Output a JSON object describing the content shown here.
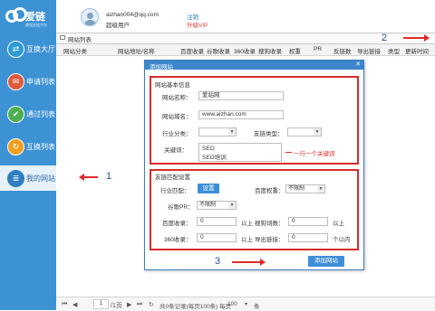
{
  "app": {
    "name": "爱链",
    "subtitle": "最强友链平台"
  },
  "sidebar": {
    "items": [
      {
        "label": "互换大厅",
        "icon": "exchange-hall-icon",
        "color": "#2f9bd6"
      },
      {
        "label": "申请列表",
        "icon": "apply-list-icon",
        "color": "#e05a3a"
      },
      {
        "label": "通过列表",
        "icon": "approved-list-icon",
        "color": "#4caf50"
      },
      {
        "label": "互换列表",
        "icon": "swap-list-icon",
        "color": "#f0a020"
      },
      {
        "label": "我的网站",
        "icon": "my-sites-icon",
        "color": "#2f7fc1"
      }
    ]
  },
  "user": {
    "email": "aizhan004@qq.com",
    "role": "超级用户",
    "logout": "注销",
    "upgrade": "升级VIP"
  },
  "tab": {
    "label": "网站列表"
  },
  "table": {
    "headers": [
      "网站分类",
      "网站地址/名称",
      "百度收录",
      "谷歌收录",
      "360收录",
      "搜狗收录",
      "权重",
      "PR",
      "反链数",
      "导出链接",
      "类型",
      "更新时间"
    ]
  },
  "pager": {
    "first": "⏮",
    "prev": "◀",
    "page": "1",
    "of": "/1页",
    "next": "▶",
    "last": "⏭",
    "refresh": "↻",
    "summary": "共0条记录(每页100条) 每页",
    "per_page": "100",
    "unit": "条"
  },
  "dialog": {
    "title": "添加网站",
    "close": "✕",
    "basic": {
      "title": "网站基本信息",
      "name_label": "网站名称：",
      "name_value": "爱站网",
      "domain_label": "网站域名：",
      "domain_value": "www.aizhan.com",
      "category_label": "行业分类：",
      "category_value": "",
      "linktype_label": "友链类型：",
      "linktype_value": "",
      "keywords_label": "关键词：",
      "keywords": [
        "SEO",
        "SEO培训"
      ],
      "keywords_note": "一行一个关键词"
    },
    "match": {
      "title": "友链匹配设置",
      "industry_label": "行业匹配：",
      "industry_button": "设置",
      "baidu_weight_label": "百度权重：",
      "baidu_weight_value": "不限制",
      "google_pr_label": "谷歌PR：",
      "google_pr_value": "不限制",
      "baidu_index_label": "百度收录：",
      "baidu_index_value": "0",
      "baidu_index_unit": "以上",
      "sogou_index_label": "搜狗词数：",
      "sogou_index_value": "0",
      "sogou_index_unit": "以上",
      "s360_index_label": "360收录：",
      "s360_index_value": "0",
      "s360_index_unit": "以上",
      "export_links_label": "导出链接：",
      "export_links_value": "0",
      "export_links_unit": "个以内"
    },
    "submit": "添加网站"
  },
  "annotations": {
    "n1": "1",
    "n2": "2",
    "n3": "3"
  },
  "colors": {
    "sidebar": "#3d92d4",
    "accent": "#3d86cc",
    "highlight": "#d82a2a"
  }
}
